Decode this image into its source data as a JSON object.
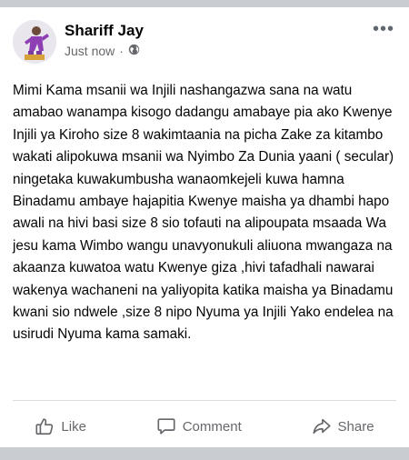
{
  "post": {
    "author": "Shariff Jay",
    "timestamp": "Just now",
    "separator": "·",
    "privacy_icon": "globe-icon",
    "more_label": "•••",
    "text": "Mimi Kama msanii wa Injili nashangazwa sana na watu amabao wanampa kisogo dadangu amabaye pia ako Kwenye Injili ya Kiroho size 8 wakimtaania na picha Zake za kitambo wakati alipokuwa msanii wa Nyimbo Za Dunia yaani ( secular) ningetaka kuwakumbusha wanaomkejeli kuwa hamna Binadamu ambaye hajapitia Kwenye maisha ya dhambi hapo awali na hivi basi size 8 sio tofauti na alipoupata msaada Wa jesu kama Wimbo wangu unavyonukuli aliuona mwangaza na akaanza kuwatoa watu Kwenye giza ,hivi tafadhali nawarai wakenya wachaneni na yaliyopita katika maisha ya Binadamu kwani sio ndwele ,size 8 nipo Nyuma ya Injili Yako endelea na usirudi Nyuma kama samaki."
  },
  "actions": {
    "like": "Like",
    "comment": "Comment",
    "share": "Share"
  },
  "colors": {
    "background": "#c9ccd1",
    "card": "#ffffff",
    "secondary_text": "#65676b",
    "avatar_suit": "#8e3fb3"
  }
}
